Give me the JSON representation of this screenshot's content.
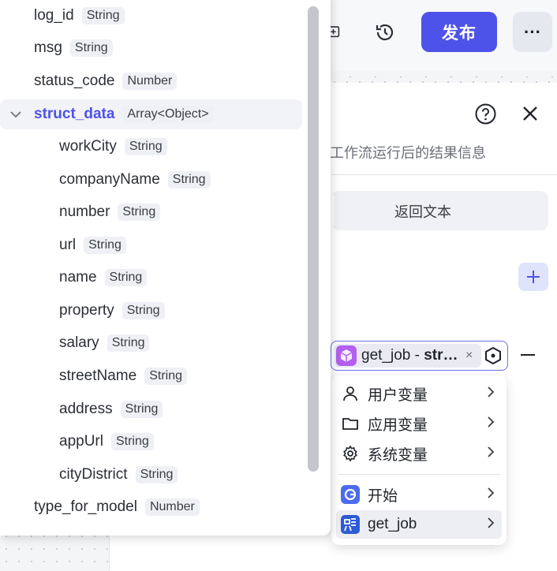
{
  "toolbar": {
    "publish_label": "发布",
    "more_label": "···"
  },
  "panel": {
    "description": "工作流运行后的结果信息",
    "segment_label": "返回文本"
  },
  "variable_tag": {
    "text_prefix": "get_job - ",
    "text_bold": "str…",
    "close_label": "×"
  },
  "cascade_menu": {
    "items": [
      {
        "label": "用户变量",
        "icon": "user-icon"
      },
      {
        "label": "应用变量",
        "icon": "folder-icon"
      },
      {
        "label": "系统变量",
        "icon": "gear-icon"
      },
      {
        "label": "开始",
        "icon": "start-node-icon"
      },
      {
        "label": "get_job",
        "icon": "get-job-plugin-icon"
      }
    ]
  },
  "tree": {
    "fields": [
      {
        "name": "log_id",
        "type": "String",
        "level": 0
      },
      {
        "name": "msg",
        "type": "String",
        "level": 0
      },
      {
        "name": "status_code",
        "type": "Number",
        "level": 0
      },
      {
        "name": "struct_data",
        "type": "Array<Object>",
        "level": 0,
        "expanded": true,
        "selected": true
      },
      {
        "name": "workCity",
        "type": "String",
        "level": 1
      },
      {
        "name": "companyName",
        "type": "String",
        "level": 1
      },
      {
        "name": "number",
        "type": "String",
        "level": 1
      },
      {
        "name": "url",
        "type": "String",
        "level": 1
      },
      {
        "name": "name",
        "type": "String",
        "level": 1
      },
      {
        "name": "property",
        "type": "String",
        "level": 1
      },
      {
        "name": "salary",
        "type": "String",
        "level": 1
      },
      {
        "name": "streetName",
        "type": "String",
        "level": 1
      },
      {
        "name": "address",
        "type": "String",
        "level": 1
      },
      {
        "name": "appUrl",
        "type": "String",
        "level": 1
      },
      {
        "name": "cityDistrict",
        "type": "String",
        "level": 1
      },
      {
        "name": "type_for_model",
        "type": "Number",
        "level": 0
      }
    ]
  },
  "colors": {
    "accent": "#4d53e8",
    "tag_border": "#6a6ff0"
  }
}
